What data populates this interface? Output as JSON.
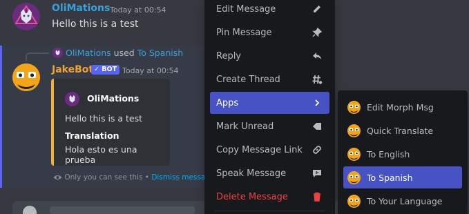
{
  "message1": {
    "username": "OliMations",
    "timestamp": "Today at 00:54",
    "text": "Hello this is a test"
  },
  "reply": {
    "user": "OliMations",
    "verb": "used",
    "app": "To Spanish"
  },
  "message2": {
    "username": "JakeBot",
    "badge": "✓ BOT",
    "timestamp": "Today at 00:54",
    "embed": {
      "author": "OliMations",
      "description": "Hello this is a test",
      "field_name": "Translation",
      "field_value": "Hola esto es una prueba",
      "accent_color": "#f0b232"
    },
    "ephemeral_note": "Only you can see this",
    "ephemeral_sep": "•",
    "dismiss_label": "Dismiss message"
  },
  "context_menu": {
    "items": [
      {
        "label": "Edit Message",
        "icon": "pencil-icon"
      },
      {
        "label": "Pin Message",
        "icon": "pin-icon"
      },
      {
        "label": "Reply",
        "icon": "reply-icon"
      },
      {
        "label": "Create Thread",
        "icon": "thread-icon"
      },
      {
        "label": "Apps",
        "icon": "chevron-right-icon",
        "active": true
      },
      {
        "label": "Mark Unread",
        "icon": "mark-unread-icon"
      },
      {
        "label": "Copy Message Link",
        "icon": "link-icon"
      },
      {
        "label": "Speak Message",
        "icon": "speak-icon"
      },
      {
        "label": "Delete Message",
        "icon": "trash-icon",
        "danger": true
      }
    ]
  },
  "apps_submenu": {
    "items": [
      {
        "label": "Edit Morph Msg"
      },
      {
        "label": "Quick Translate"
      },
      {
        "label": "To English"
      },
      {
        "label": "To Spanish",
        "active": true
      },
      {
        "label": "To Your Language"
      }
    ]
  },
  "colors": {
    "username_blue": "#3ba1d8",
    "username_orange": "#f0a232",
    "accent": "#5865f2",
    "danger": "#ed4245"
  }
}
